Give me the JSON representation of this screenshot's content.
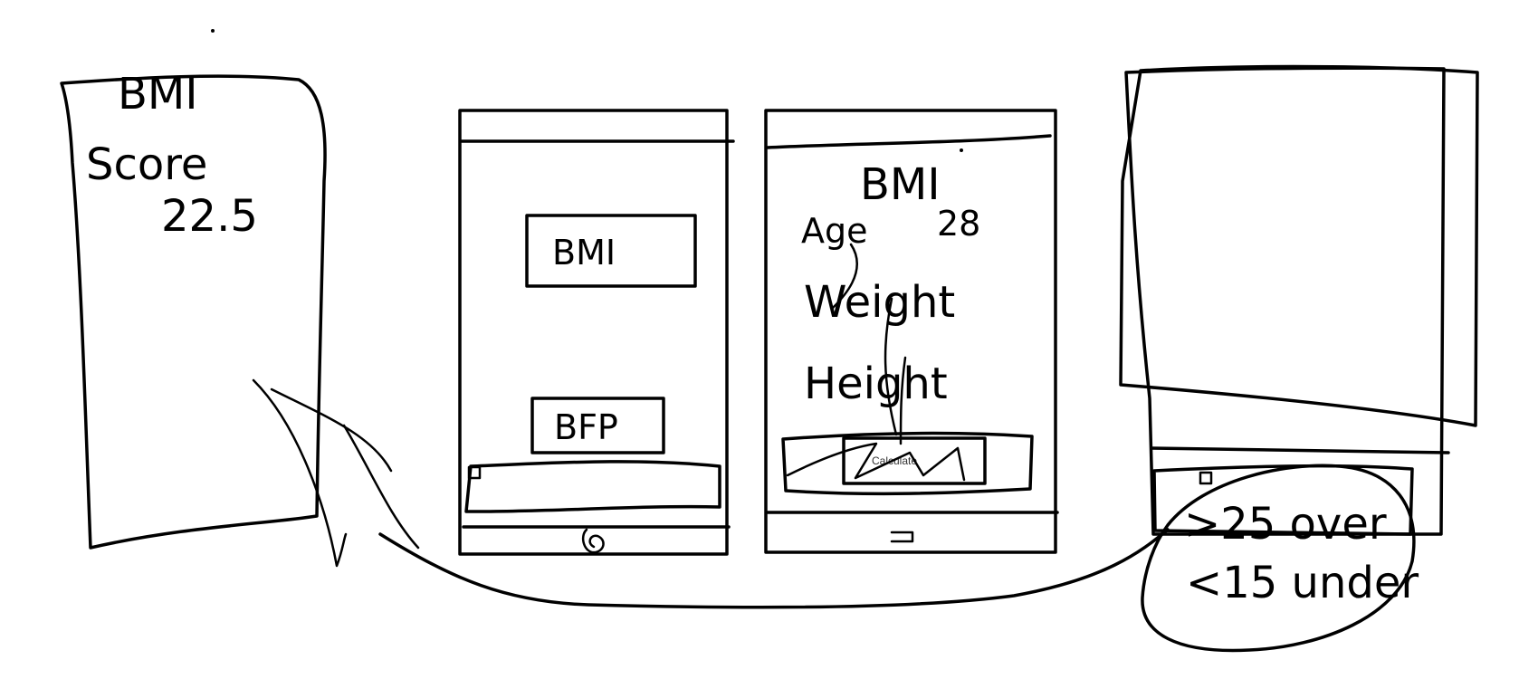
{
  "score_panel": {
    "title": "BMI",
    "label": "Score",
    "value": "22.5"
  },
  "home_screen": {
    "bmi_button": "BMI",
    "bfp_button": "BFP"
  },
  "input_screen": {
    "title": "BMI",
    "age_label": "Age",
    "age_value": "28",
    "weight_label": "Weight",
    "height_label": "Height",
    "calculate_button": "Calculate"
  },
  "result_screen": {
    "over_note": ">25 over",
    "under_note": "<15 under"
  },
  "colors": {
    "ink": "#000000",
    "background": "#ffffff"
  }
}
